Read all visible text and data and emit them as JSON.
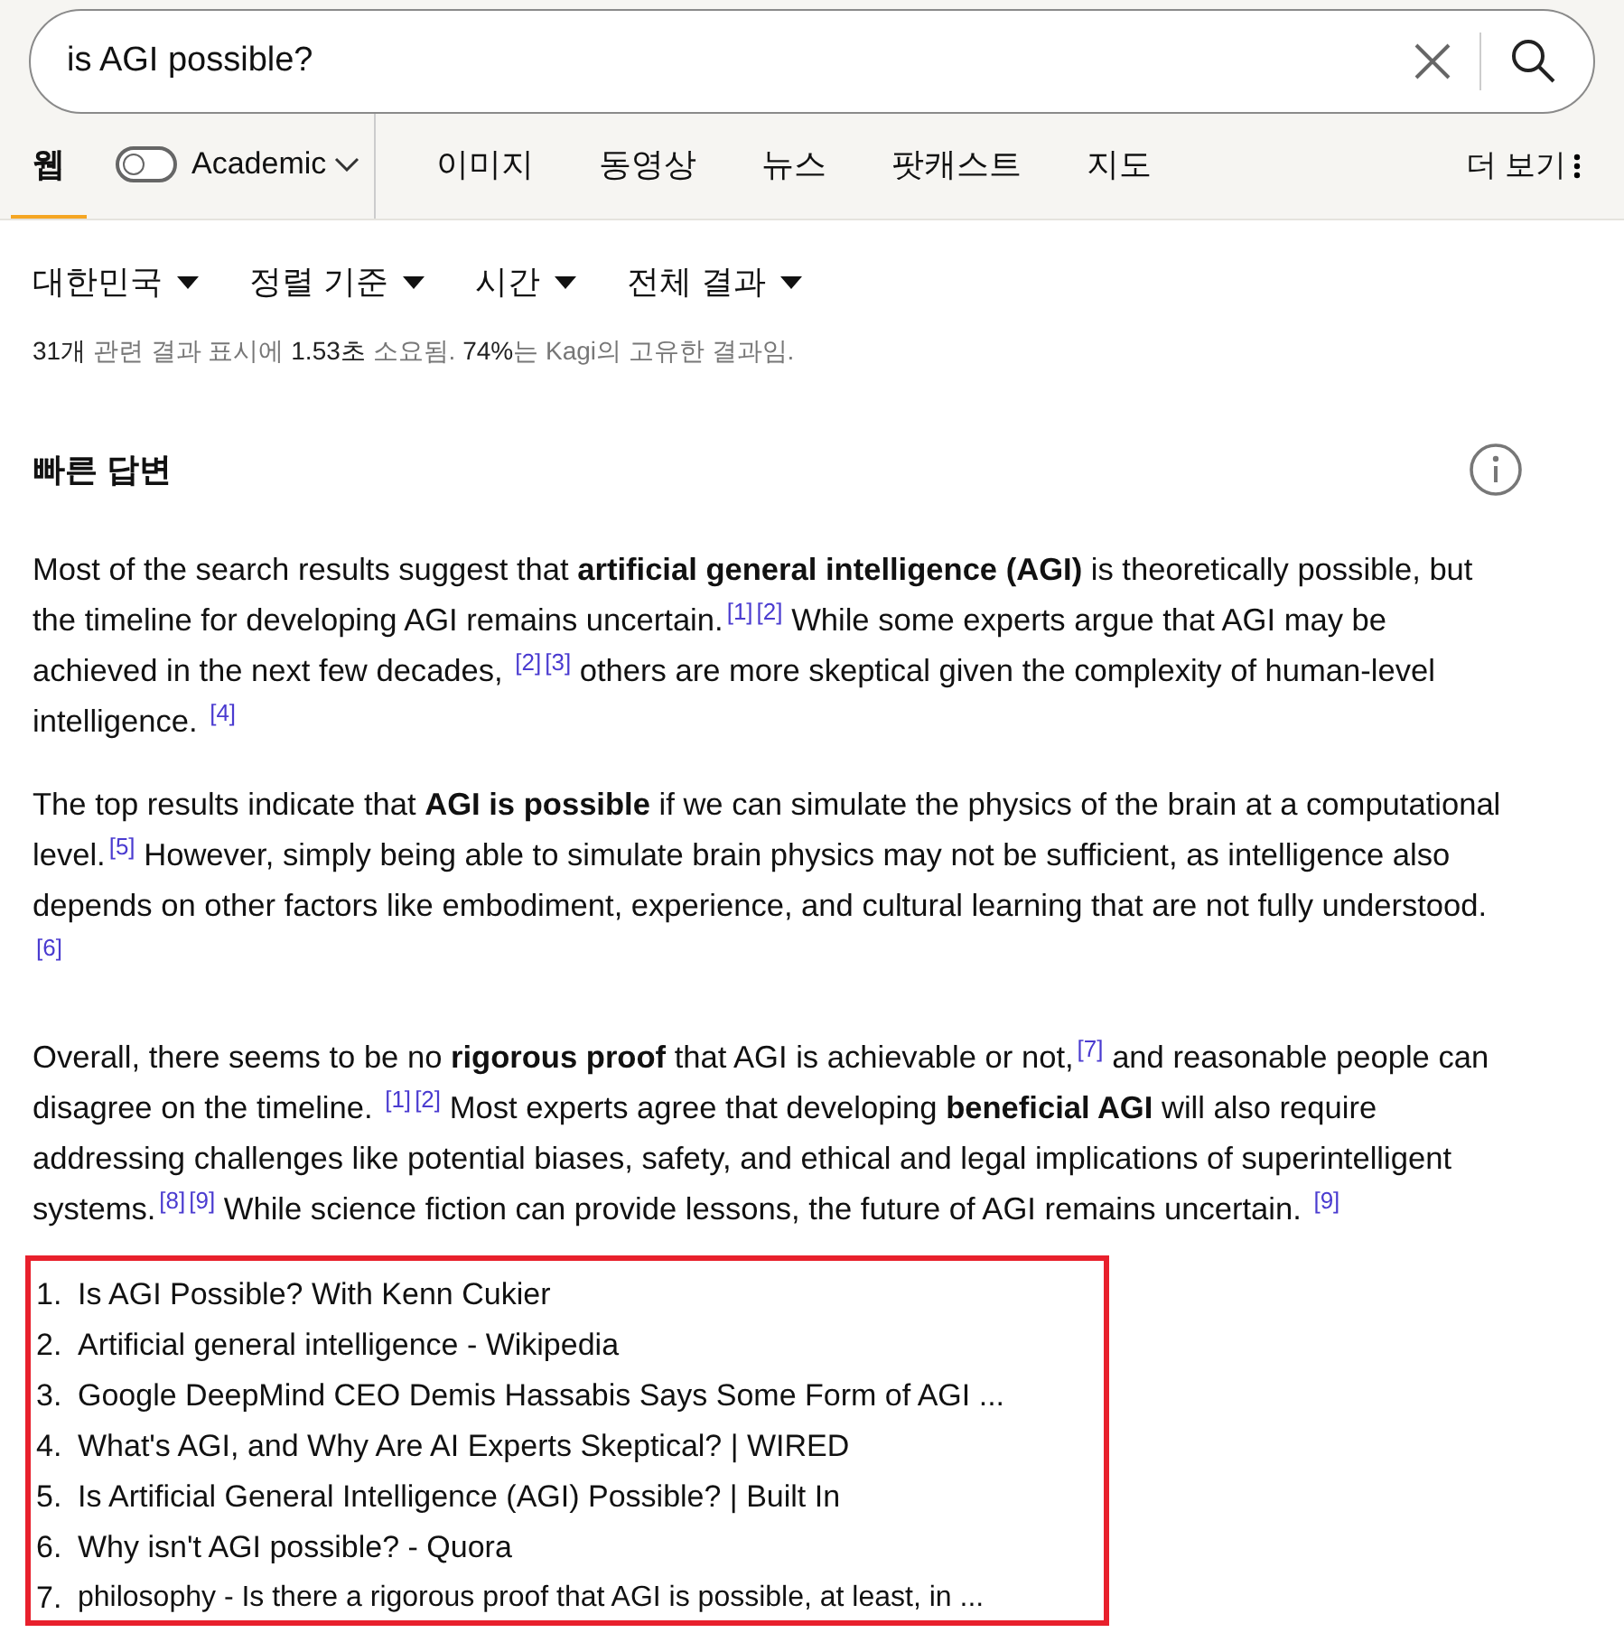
{
  "search": {
    "value": "is AGI possible?"
  },
  "tabs": [
    {
      "label": "웹",
      "selected": true,
      "kind": "tab"
    },
    {
      "label": "Academic",
      "selected": false,
      "kind": "toggle",
      "on": false
    },
    {
      "label": "이미지",
      "selected": false,
      "kind": "tab"
    },
    {
      "label": "동영상",
      "selected": false,
      "kind": "tab"
    },
    {
      "label": "뉴스",
      "selected": false,
      "kind": "tab"
    },
    {
      "label": "팟캐스트",
      "selected": false,
      "kind": "tab"
    },
    {
      "label": "지도",
      "selected": false,
      "kind": "tab"
    }
  ],
  "more": {
    "label": "더 보기"
  },
  "filters": [
    {
      "label": "대한민국"
    },
    {
      "label": "정렬 기준"
    },
    {
      "label": "시간"
    },
    {
      "label": "전체 결과"
    }
  ],
  "stats": [
    {
      "text": "31개",
      "strong": true
    },
    {
      "text": " 관련 결과 표시에 ",
      "strong": false
    },
    {
      "text": "1.53초",
      "strong": true
    },
    {
      "text": " 소요됨. ",
      "strong": false
    },
    {
      "text": "74%",
      "strong": true
    },
    {
      "text": "는 Kagi의 고유한 결과임.",
      "strong": false
    }
  ],
  "quick_answer": {
    "title": "빠른 답변",
    "paragraphs": [
      "Most of the search results suggest that **artificial general intelligence (AGI)** is theoretically possible, but the timeline for developing AGI remains uncertain.$^{[1]}$$^{[2]}$ While some experts argue that AGI may be achieved in the next few decades, $^{[2]}$$^{[3]}$ others are more skeptical given the complexity of human-level intelligence. $^{[4]}$",
      "The top results indicate that **AGI is possible** if we can simulate the physics of the brain at a computational level.$^{[5]}$ However, simply being able to simulate brain physics may not be sufficient, as intelligence also depends on other factors like embodiment, experience, and cultural learning that are not fully understood. $^{[6]}$",
      "Overall, there seems to be no **rigorous proof** that AGI is achievable or not,$^{[7]}$ and reasonable people can disagree on the timeline. $^{[1]}$$^{[2]}$ Most experts agree that developing **beneficial AGI** will also require addressing challenges like potential biases, safety, and ethical and legal implications of superintelligent systems.$^{[8]}$$^{[9]}$ While science fiction can provide lessons, the future of AGI remains uncertain. $^{[9]}$"
    ],
    "sources": [
      {
        "number": "1.",
        "title": "Is AGI Possible? With Kenn Cukier"
      },
      {
        "number": "2.",
        "title": "Artificial general intelligence - Wikipedia"
      },
      {
        "number": "3.",
        "title": "Google DeepMind CEO Demis Hassabis Says Some Form of AGI ..."
      },
      {
        "number": "4.",
        "title": "What's AGI, and Why Are AI Experts Skeptical? | WIRED"
      },
      {
        "number": "5.",
        "title": "Is Artificial General Intelligence (AGI) Possible? | Built In"
      },
      {
        "number": "6.",
        "title": "Why isn't AGI possible? - Quora"
      },
      {
        "number": "7.",
        "title": "philosophy - Is there a rigorous proof that AGI is possible, at least, in ..."
      }
    ]
  }
}
